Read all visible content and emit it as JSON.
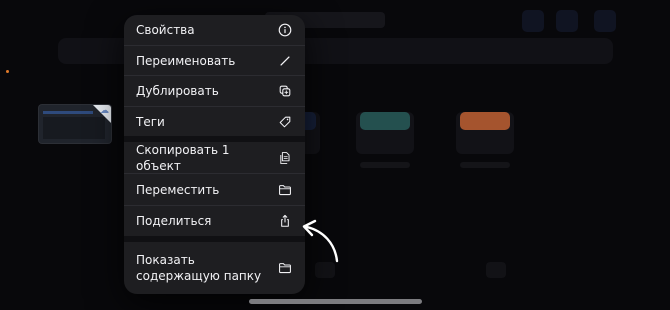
{
  "context_menu": {
    "items": [
      {
        "label": "Свойства",
        "icon": "info-circle-icon"
      },
      {
        "label": "Переименовать",
        "icon": "pencil-icon"
      },
      {
        "label": "Дублировать",
        "icon": "duplicate-icon"
      },
      {
        "label": "Теги",
        "icon": "tag-icon"
      },
      {
        "label": "Скопировать 1 объект",
        "icon": "copy-document-icon"
      },
      {
        "label": "Переместить",
        "icon": "folder-icon"
      },
      {
        "label": "Поделиться",
        "icon": "share-icon"
      },
      {
        "label": "Показать содержащую папку",
        "icon": "folder-icon"
      }
    ]
  },
  "colors": {
    "background": "#08080b",
    "menu_background": "#1e1e21",
    "menu_text": "#f2f2f5",
    "annotation_arrow": "#ffffff"
  }
}
